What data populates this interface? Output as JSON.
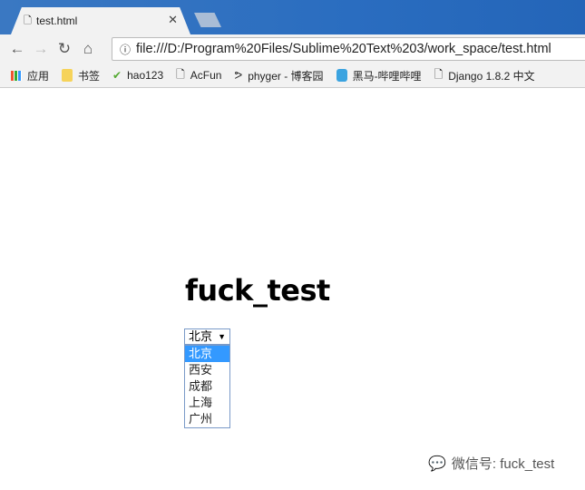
{
  "tab": {
    "title": "test.html"
  },
  "address": {
    "url": "file:///D:/Program%20Files/Sublime%20Text%203/work_space/test.html"
  },
  "bookmarks": [
    "应用",
    "书签",
    "hao123",
    "AcFun",
    "phyger - 博客园",
    "黑马-哔哩哔哩",
    "Django 1.8.2 中文"
  ],
  "page": {
    "heading": "fuck_test",
    "select": {
      "value": "北京",
      "options": [
        "北京",
        "西安",
        "成都",
        "上海",
        "广州"
      ],
      "highlighted": "北京"
    }
  },
  "watermark": "微信号: fuck_test"
}
